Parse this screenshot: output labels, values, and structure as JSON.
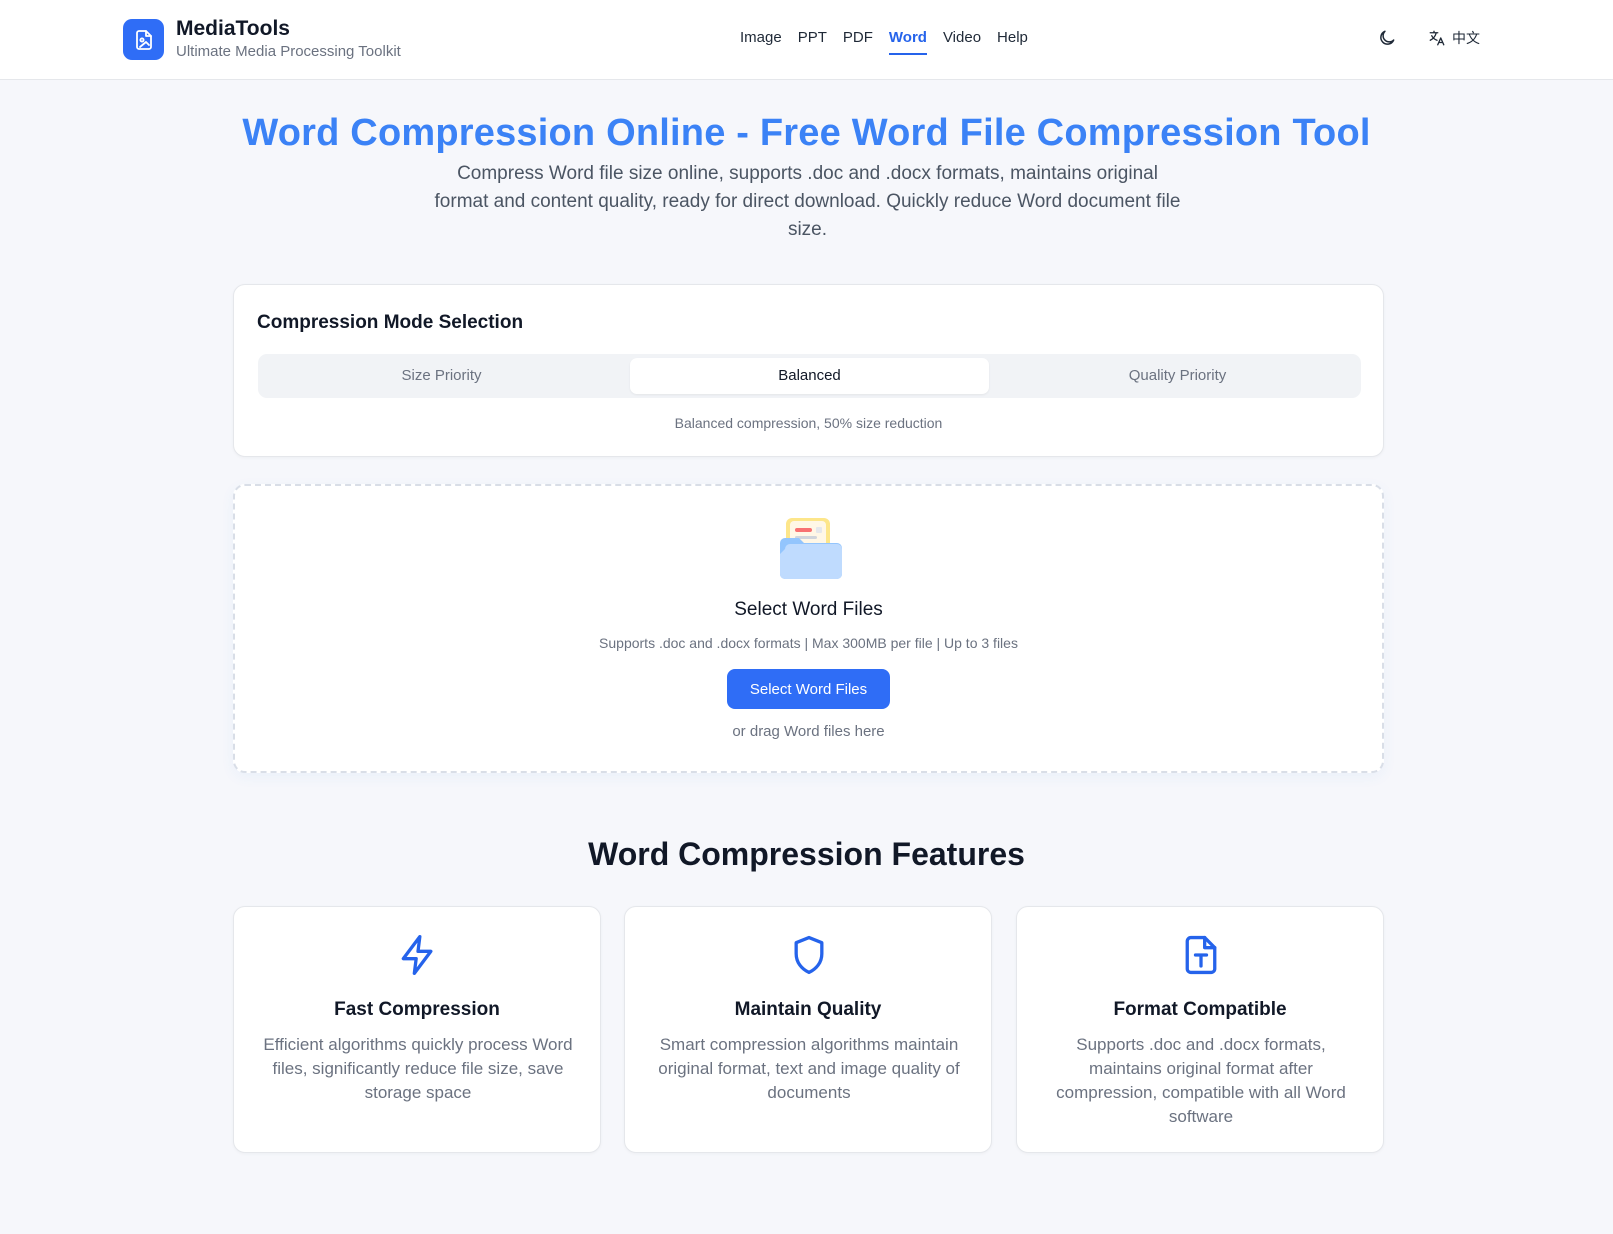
{
  "header": {
    "brand_name": "MediaTools",
    "brand_tagline": "Ultimate Media Processing Toolkit",
    "nav": [
      {
        "label": "Image",
        "active": false
      },
      {
        "label": "PPT",
        "active": false
      },
      {
        "label": "PDF",
        "active": false
      },
      {
        "label": "Word",
        "active": true
      },
      {
        "label": "Video",
        "active": false
      },
      {
        "label": "Help",
        "active": false
      }
    ],
    "theme_icon": "moon-icon",
    "language_label": "中文",
    "language_icon": "translate-icon"
  },
  "hero": {
    "title": "Word Compression Online - Free Word File Compression Tool",
    "description": "Compress Word file size online, supports .doc and .docx formats, maintains original format and content quality, ready for direct download. Quickly reduce Word document file size."
  },
  "mode": {
    "title": "Compression Mode Selection",
    "tabs": [
      {
        "label": "Size Priority",
        "selected": false
      },
      {
        "label": "Balanced",
        "selected": true
      },
      {
        "label": "Quality Priority",
        "selected": false
      }
    ],
    "description": "Balanced compression, 50% size reduction"
  },
  "upload": {
    "icon": "folder-icon",
    "title": "Select Word Files",
    "hint": "Supports .doc and .docx formats | Max 300MB per file | Up to 3 files",
    "button_label": "Select Word Files",
    "drag_text": "or drag Word files here"
  },
  "features": {
    "title": "Word Compression Features",
    "items": [
      {
        "icon": "lightning-icon",
        "name": "Fast Compression",
        "description": "Efficient algorithms quickly process Word files, significantly reduce file size, save storage space"
      },
      {
        "icon": "shield-icon",
        "name": "Maintain Quality",
        "description": "Smart compression algorithms maintain original format, text and image quality of documents"
      },
      {
        "icon": "document-type-icon",
        "name": "Format Compatible",
        "description": "Supports .doc and .docx formats, maintains original format after compression, compatible with all Word software"
      }
    ]
  },
  "colors": {
    "accent": "#2f6df6",
    "title_blue": "#3b82f6",
    "background": "#f6f7fb"
  }
}
